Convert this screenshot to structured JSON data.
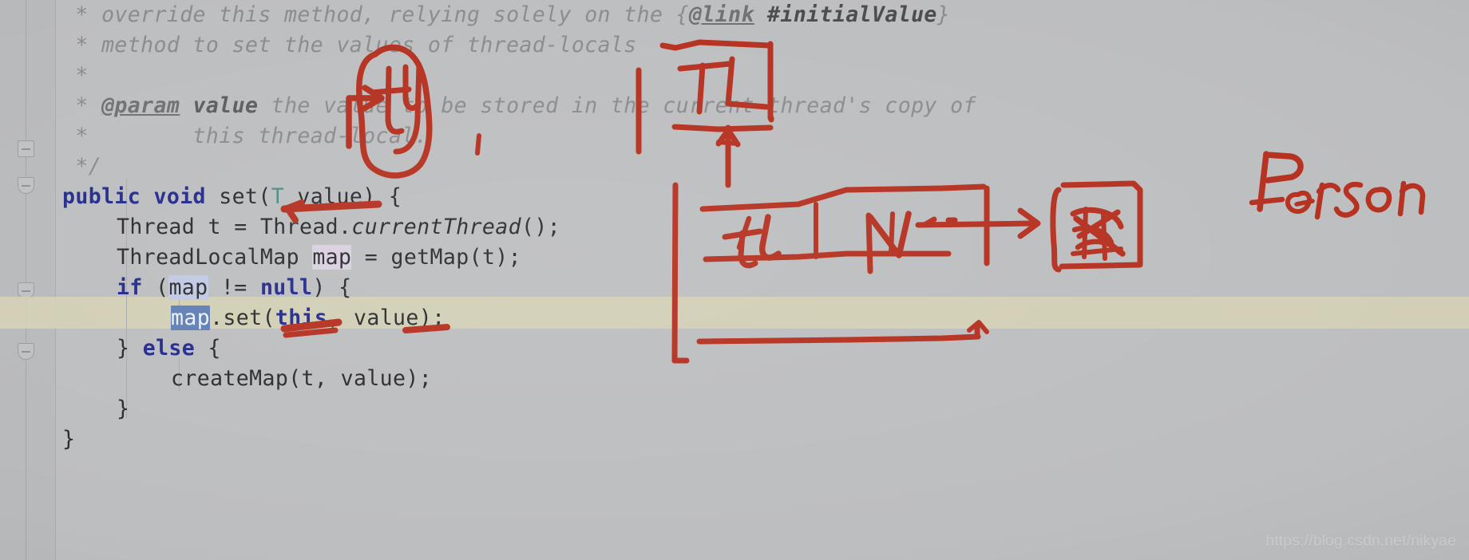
{
  "app": {
    "kind": "code-editor-screenshot-with-handwritten-annotations",
    "language": "Java",
    "theme_background": "#bdbec0",
    "caret_line_color": "#d6d2b4",
    "keyword_color": "#232a8c",
    "comment_color": "#8a8b8d",
    "ink_color": "#b5301f"
  },
  "code": {
    "lines": [
      {
        "indent": 0,
        "segments": [
          {
            "t": " * ",
            "c": "cmt"
          },
          {
            "t": "override this method, relying solely on the ",
            "c": "cmt"
          },
          {
            "t": "{",
            "c": "cmt"
          },
          {
            "t": "@link",
            "c": "cmt-link"
          },
          {
            "t": " ",
            "c": "cmt"
          },
          {
            "t": "#initialValue",
            "c": "cmt-code"
          },
          {
            "t": "}",
            "c": "cmt"
          }
        ]
      },
      {
        "indent": 0,
        "segments": [
          {
            "t": " * ",
            "c": "cmt"
          },
          {
            "t": "method to set the values of thread-locals",
            "c": "cmt"
          }
        ]
      },
      {
        "indent": 0,
        "segments": [
          {
            "t": " *",
            "c": "cmt"
          }
        ]
      },
      {
        "indent": 0,
        "segments": [
          {
            "t": " * ",
            "c": "cmt"
          },
          {
            "t": "@param",
            "c": "cmt-tag"
          },
          {
            "t": " ",
            "c": "cmt"
          },
          {
            "t": "value",
            "c": "cmt-b"
          },
          {
            "t": " the value to be stored in the current thread's copy of",
            "c": "cmt"
          }
        ]
      },
      {
        "indent": 0,
        "segments": [
          {
            "t": " *        ",
            "c": "cmt"
          },
          {
            "t": "this thread-local.",
            "c": "cmt"
          }
        ]
      },
      {
        "indent": 0,
        "segments": [
          {
            "t": " */",
            "c": "cmt"
          }
        ]
      },
      {
        "indent": 0,
        "segments": [
          {
            "t": "public void ",
            "c": "kw"
          },
          {
            "t": "set(",
            "c": "plain"
          },
          {
            "t": "T",
            "c": "typ"
          },
          {
            "t": " value) {",
            "c": "plain"
          }
        ]
      },
      {
        "indent": 1,
        "segments": [
          {
            "t": "Thread t = Thread.",
            "c": "plain"
          },
          {
            "t": "currentThread",
            "c": "ital"
          },
          {
            "t": "();",
            "c": "plain"
          }
        ]
      },
      {
        "indent": 1,
        "segments": [
          {
            "t": "ThreadLocalMap ",
            "c": "plain"
          },
          {
            "t": "map",
            "c": "plain",
            "hl": "hl-soft"
          },
          {
            "t": " = getMap(t);",
            "c": "plain"
          }
        ]
      },
      {
        "indent": 1,
        "segments": [
          {
            "t": "if ",
            "c": "kw"
          },
          {
            "t": "(",
            "c": "plain"
          },
          {
            "t": "map",
            "c": "plain",
            "hl": "hl-blue"
          },
          {
            "t": " != ",
            "c": "plain"
          },
          {
            "t": "null",
            "c": "kw"
          },
          {
            "t": ") {",
            "c": "plain"
          }
        ]
      },
      {
        "indent": 2,
        "segments": [
          {
            "t": "map",
            "c": "plain",
            "hl": "hl-sel"
          },
          {
            "t": ".set(",
            "c": "plain"
          },
          {
            "t": "this",
            "c": "kw"
          },
          {
            "t": ", value);",
            "c": "plain"
          }
        ]
      },
      {
        "indent": 1,
        "segments": [
          {
            "t": "} ",
            "c": "plain"
          },
          {
            "t": "else",
            "c": "kw"
          },
          {
            "t": " {",
            "c": "plain"
          }
        ]
      },
      {
        "indent": 2,
        "segments": [
          {
            "t": "createMap(t, value);",
            "c": "plain"
          }
        ]
      },
      {
        "indent": 1,
        "segments": [
          {
            "t": "}",
            "c": "plain"
          }
        ]
      },
      {
        "indent": 0,
        "segments": [
          {
            "t": "}",
            "c": "plain"
          }
        ]
      }
    ],
    "caret_line_index": 10
  },
  "annotations": {
    "circle_value_label": "ty",
    "threadlocal_box_label": "TL",
    "table_cell_key_label": "tL",
    "table_cell_value_label": "V",
    "person_label": "Person",
    "person_box_content": "scribble"
  },
  "watermark": {
    "text": "https://blog.csdn.net/nikyae"
  }
}
